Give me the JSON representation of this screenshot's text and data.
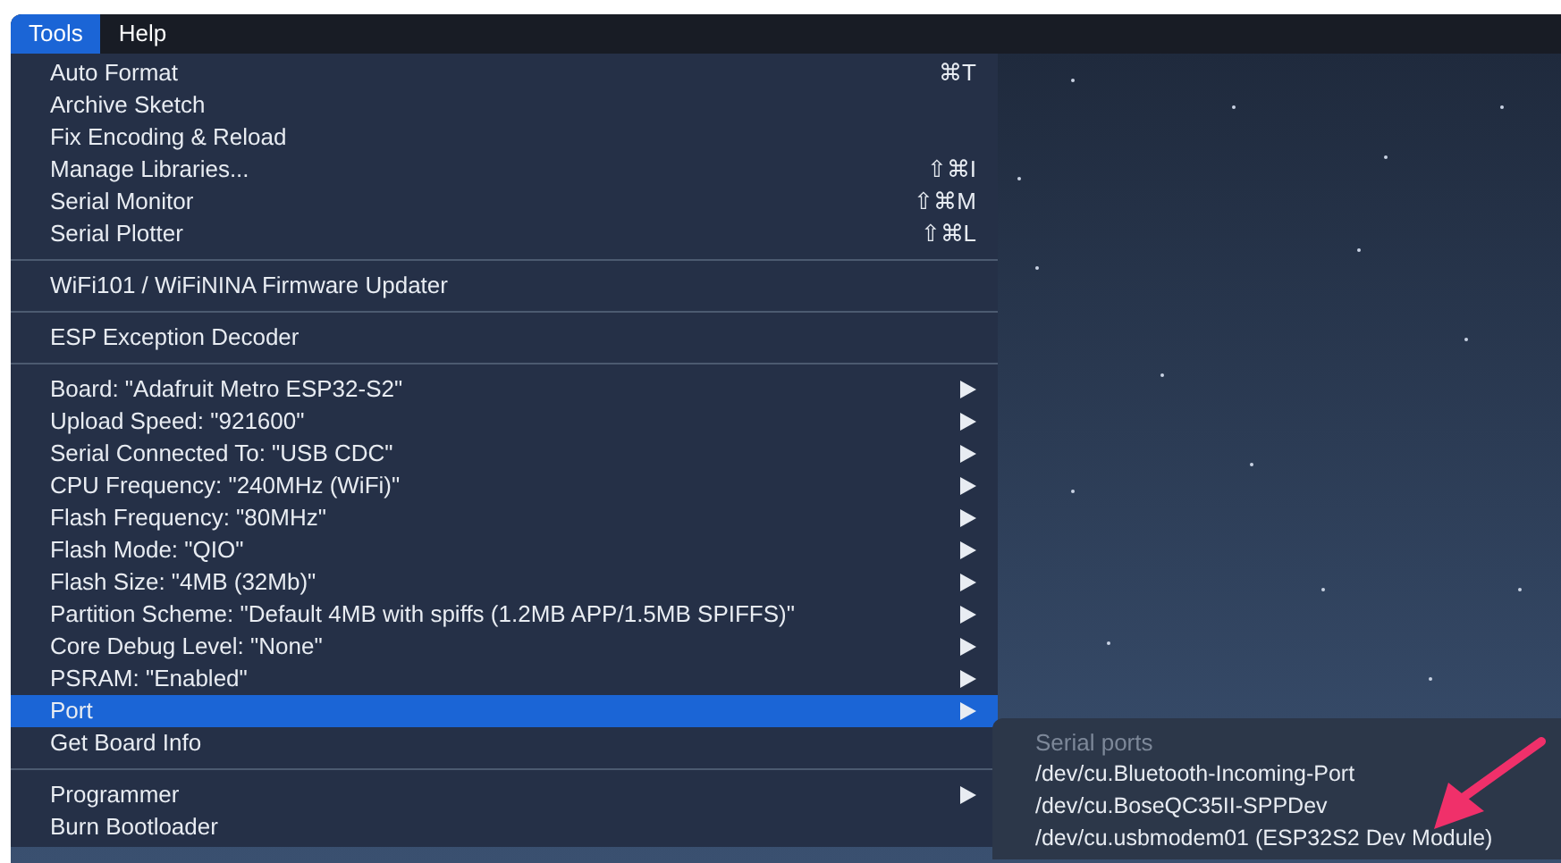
{
  "menubar": [
    {
      "label": "Tools",
      "selected": true
    },
    {
      "label": "Help",
      "selected": false
    }
  ],
  "menu_sections": [
    {
      "items": [
        {
          "label": "Auto Format",
          "shortcut": "⌘T",
          "submenu": false,
          "selected": false
        },
        {
          "label": "Archive Sketch",
          "submenu": false,
          "selected": false
        },
        {
          "label": "Fix Encoding & Reload",
          "submenu": false,
          "selected": false
        },
        {
          "label": "Manage Libraries...",
          "shortcut": "⇧⌘I",
          "submenu": false,
          "selected": false
        },
        {
          "label": "Serial Monitor",
          "shortcut": "⇧⌘M",
          "submenu": false,
          "selected": false
        },
        {
          "label": "Serial Plotter",
          "shortcut": "⇧⌘L",
          "submenu": false,
          "selected": false
        }
      ]
    },
    {
      "items": [
        {
          "label": "WiFi101 / WiFiNINA Firmware Updater",
          "submenu": false,
          "selected": false
        }
      ]
    },
    {
      "items": [
        {
          "label": "ESP Exception Decoder",
          "submenu": false,
          "selected": false
        }
      ]
    },
    {
      "items": [
        {
          "label": "Board: \"Adafruit Metro ESP32-S2\"",
          "submenu": true,
          "selected": false
        },
        {
          "label": "Upload Speed: \"921600\"",
          "submenu": true,
          "selected": false
        },
        {
          "label": "Serial Connected To: \"USB CDC\"",
          "submenu": true,
          "selected": false
        },
        {
          "label": "CPU Frequency: \"240MHz (WiFi)\"",
          "submenu": true,
          "selected": false
        },
        {
          "label": "Flash Frequency: \"80MHz\"",
          "submenu": true,
          "selected": false
        },
        {
          "label": "Flash Mode: \"QIO\"",
          "submenu": true,
          "selected": false
        },
        {
          "label": "Flash Size: \"4MB (32Mb)\"",
          "submenu": true,
          "selected": false
        },
        {
          "label": "Partition Scheme: \"Default 4MB with spiffs (1.2MB APP/1.5MB SPIFFS)\"",
          "submenu": true,
          "selected": false
        },
        {
          "label": "Core Debug Level: \"None\"",
          "submenu": true,
          "selected": false
        },
        {
          "label": "PSRAM: \"Enabled\"",
          "submenu": true,
          "selected": false
        },
        {
          "label": "Port",
          "submenu": true,
          "selected": true
        },
        {
          "label": "Get Board Info",
          "submenu": false,
          "selected": false
        }
      ]
    },
    {
      "items": [
        {
          "label": "Programmer",
          "submenu": true,
          "selected": false
        },
        {
          "label": "Burn Bootloader",
          "submenu": false,
          "selected": false
        }
      ]
    }
  ],
  "port_submenu": {
    "header": "Serial ports",
    "items": [
      "/dev/cu.Bluetooth-Incoming-Port",
      "/dev/cu.BoseQC35II-SPPDev",
      "/dev/cu.usbmodem01 (ESP32S2 Dev Module)"
    ]
  }
}
